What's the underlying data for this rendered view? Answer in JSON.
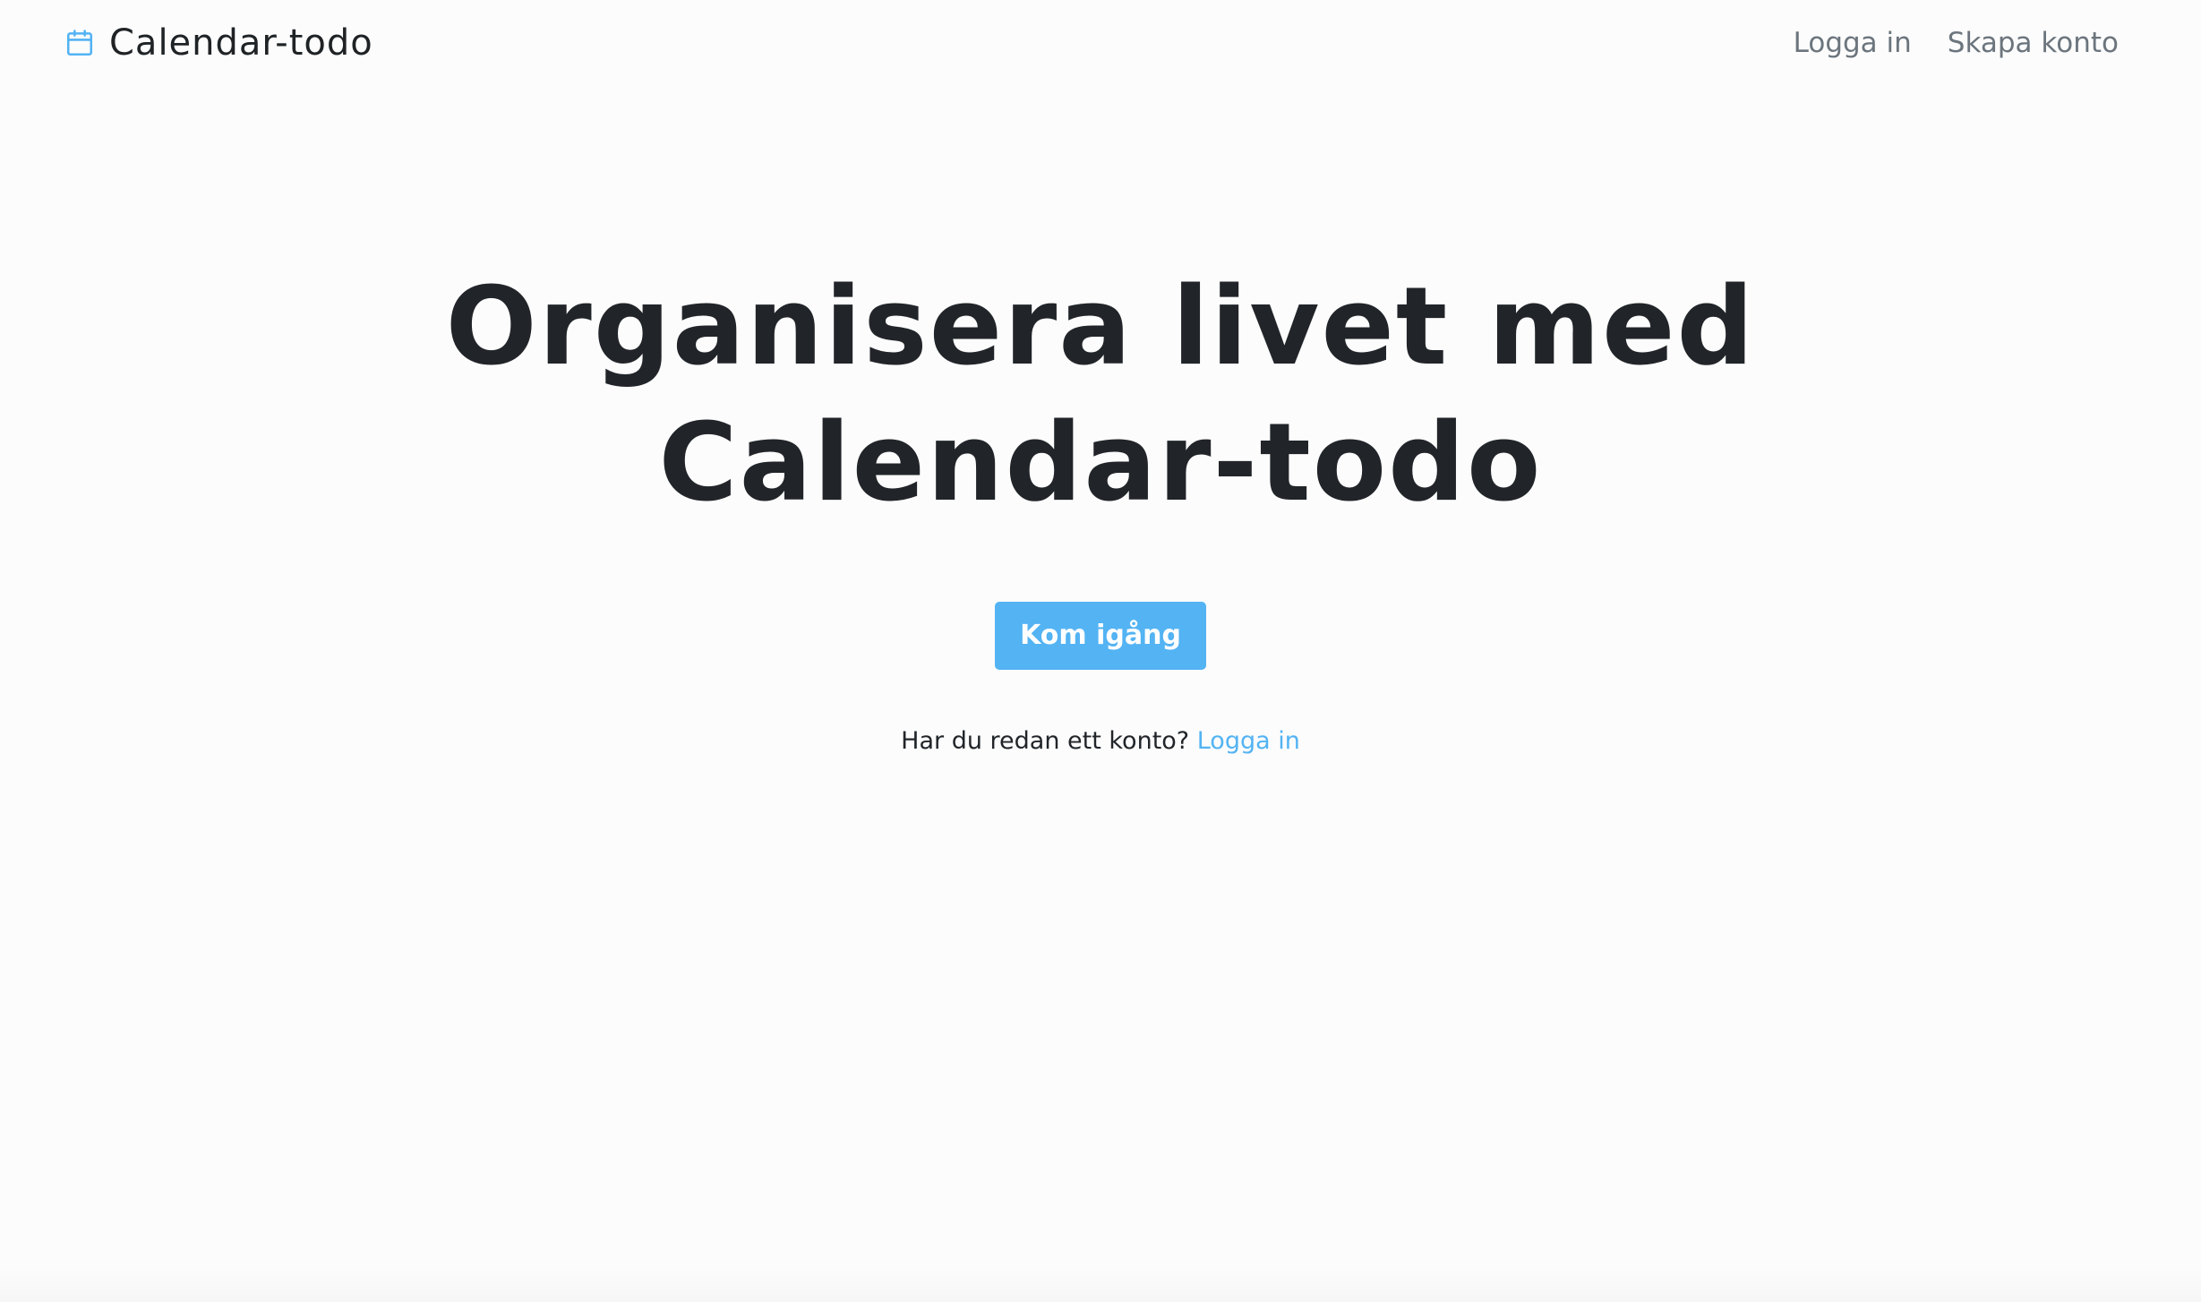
{
  "header": {
    "brand": "Calendar-todo",
    "brand_icon": "calendar-icon",
    "links": {
      "login": "Logga in",
      "signup": "Skapa konto"
    }
  },
  "hero": {
    "title_line1": "Organisera livet med",
    "title_line2": "Calendar-todo",
    "cta": "Kom igång",
    "login_prompt": "Har du redan ett konto?",
    "login_link": "Logga in"
  },
  "colors": {
    "accent": "#53b3f3",
    "text": "#212529",
    "muted": "#6c757d",
    "background": "#fcfcfc"
  }
}
